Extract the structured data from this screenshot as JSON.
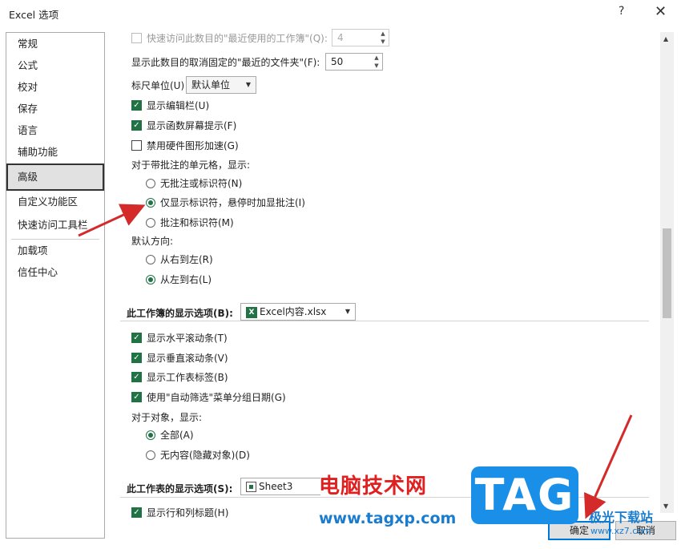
{
  "window": {
    "title": "Excel 选项",
    "help_icon": "?",
    "close_icon": "✕"
  },
  "sidebar": {
    "items": [
      {
        "label": "常规",
        "selected": false
      },
      {
        "label": "公式",
        "selected": false
      },
      {
        "label": "校对",
        "selected": false
      },
      {
        "label": "保存",
        "selected": false
      },
      {
        "label": "语言",
        "selected": false
      },
      {
        "label": "辅助功能",
        "selected": false
      },
      {
        "label": "高级",
        "selected": true
      },
      {
        "label": "自定义功能区",
        "selected": false
      },
      {
        "label": "快速访问工具栏",
        "selected": false
      },
      {
        "label": "加载项",
        "selected": false
      },
      {
        "label": "信任中心",
        "selected": false
      }
    ]
  },
  "display": {
    "quick_access_recent": {
      "label": "快速访问此数目的\"最近使用的工作簿\"(Q):",
      "value": "4",
      "checked": false,
      "disabled": true
    },
    "recent_folders": {
      "label": "显示此数目的取消固定的\"最近的文件夹\"(F):",
      "value": "50"
    },
    "ruler_units": {
      "label": "标尺单位(U)",
      "value": "默认单位"
    },
    "show_formula_bar": {
      "label": "显示编辑栏(U)",
      "checked": true
    },
    "show_function_tips": {
      "label": "显示函数屏幕提示(F)",
      "checked": true
    },
    "disable_hw_accel": {
      "label": "禁用硬件图形加速(G)",
      "checked": false
    },
    "comments_heading": "对于带批注的单元格，显示:",
    "comments_options": [
      {
        "label": "无批注或标识符(N)",
        "selected": false
      },
      {
        "label": "仅显示标识符，悬停时加显批注(I)",
        "selected": true
      },
      {
        "label": "批注和标识符(M)",
        "selected": false
      }
    ],
    "direction_heading": "默认方向:",
    "direction_options": [
      {
        "label": "从右到左(R)",
        "selected": false
      },
      {
        "label": "从左到右(L)",
        "selected": true
      }
    ]
  },
  "workbook": {
    "heading": "此工作簿的显示选项(B):",
    "file": "Excel内容.xlsx",
    "options": [
      {
        "label": "显示水平滚动条(T)",
        "checked": true
      },
      {
        "label": "显示垂直滚动条(V)",
        "checked": true
      },
      {
        "label": "显示工作表标签(B)",
        "checked": true
      },
      {
        "label": "使用\"自动筛选\"菜单分组日期(G)",
        "checked": true
      }
    ],
    "objects_heading": "对于对象，显示:",
    "objects_options": [
      {
        "label": "全部(A)",
        "selected": true
      },
      {
        "label": "无内容(隐藏对象)(D)",
        "selected": false
      }
    ]
  },
  "worksheet": {
    "heading": "此工作表的显示选项(S):",
    "sheet": "Sheet3",
    "show_headers": {
      "label": "显示行和列标题(H)",
      "checked": true
    }
  },
  "buttons": {
    "ok": "确定",
    "cancel": "取消"
  },
  "watermark": {
    "site_name": "电脑技术网",
    "url": "www.tagxp.com",
    "logo": "TAG",
    "corner_text": "极光下载站",
    "corner_url": "www.xz7.com"
  },
  "colors": {
    "accent": "#217346",
    "arrow": "#d42a2a",
    "primary_border": "#0078d7"
  }
}
